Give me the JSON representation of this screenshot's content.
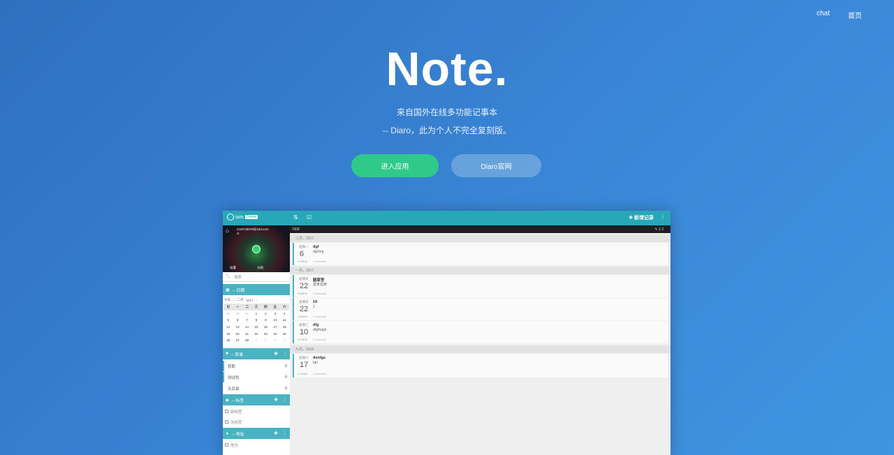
{
  "nav": {
    "items": [
      "chat",
      "首页"
    ]
  },
  "hero": {
    "title": "Note.",
    "subtitle1": "来自国外在线多功能记事本",
    "subtitle2": "-- Diaro，此为个人不完全复刻版。",
    "enter_button": "进入应用",
    "site_button": "Diaro官网"
  },
  "app": {
    "brand": "iaro",
    "brand_badge": "Online",
    "new_record": "新增记录",
    "profile": {
      "email": "m18718579@163.com",
      "email2": "cl",
      "link_left": "设置",
      "link_right": "分组"
    },
    "search_placeholder": "搜索",
    "sections": {
      "calendar": "-- 日期",
      "folders": "-- 目录",
      "tags": "-- 标签",
      "locations": "-- 地址"
    },
    "calendar": {
      "today": "今日",
      "month": "二月",
      "year": "2017",
      "weekdays": [
        "日",
        "一",
        "二",
        "三",
        "四",
        "五",
        "六"
      ],
      "weeks": [
        [
          "29",
          "30",
          "31",
          "1",
          "2",
          "3",
          "4"
        ],
        [
          "5",
          "6",
          "7",
          "8",
          "9",
          "10",
          "11"
        ],
        [
          "12",
          "13",
          "14",
          "15",
          "16",
          "17",
          "18"
        ],
        [
          "19",
          "20",
          "21",
          "22",
          "23",
          "24",
          "25"
        ],
        [
          "26",
          "27",
          "28",
          "1",
          "2",
          "3",
          "4"
        ]
      ]
    },
    "folders": [
      {
        "name": "获取",
        "count": "0"
      },
      {
        "name": "测试色",
        "count": "0"
      },
      {
        "name": "无目录",
        "count": "0"
      }
    ],
    "tags": [
      "新标签",
      "无标签"
    ],
    "locations": [
      "地方"
    ],
    "main": {
      "header": "FEB",
      "counter": "1 2",
      "groups": [
        {
          "month": "二月，2017",
          "entries": [
            {
              "dow": "星期一",
              "day": "6",
              "title": "dgf",
              "text": "dgnfng",
              "time": "3:33PM",
              "meta": "Unknown"
            }
          ]
        },
        {
          "month": "一月，2017",
          "entries": [
            {
              "dow": "星期日",
              "day": "22",
              "title": "鹤家苍",
              "text": "莫家伯家",
              "time": "5:58PM",
              "meta": "Unknown"
            },
            {
              "dow": "星期日",
              "day": "22",
              "title": "19",
              "text": "2",
              "time": "1:50PM",
              "meta": "Unknown"
            },
            {
              "dow": "星期二",
              "day": "10",
              "title": "dfg",
              "text": "dfgfhdgh",
              "time": "9:49PM",
              "meta": "Unknown"
            }
          ]
        },
        {
          "month": "九月，2016",
          "entries": [
            {
              "dow": "星期六",
              "day": "17",
              "title": "dsnfgs",
              "text": "fgh",
              "time": "2:29AM",
              "meta": "Unknown"
            }
          ]
        }
      ]
    }
  }
}
